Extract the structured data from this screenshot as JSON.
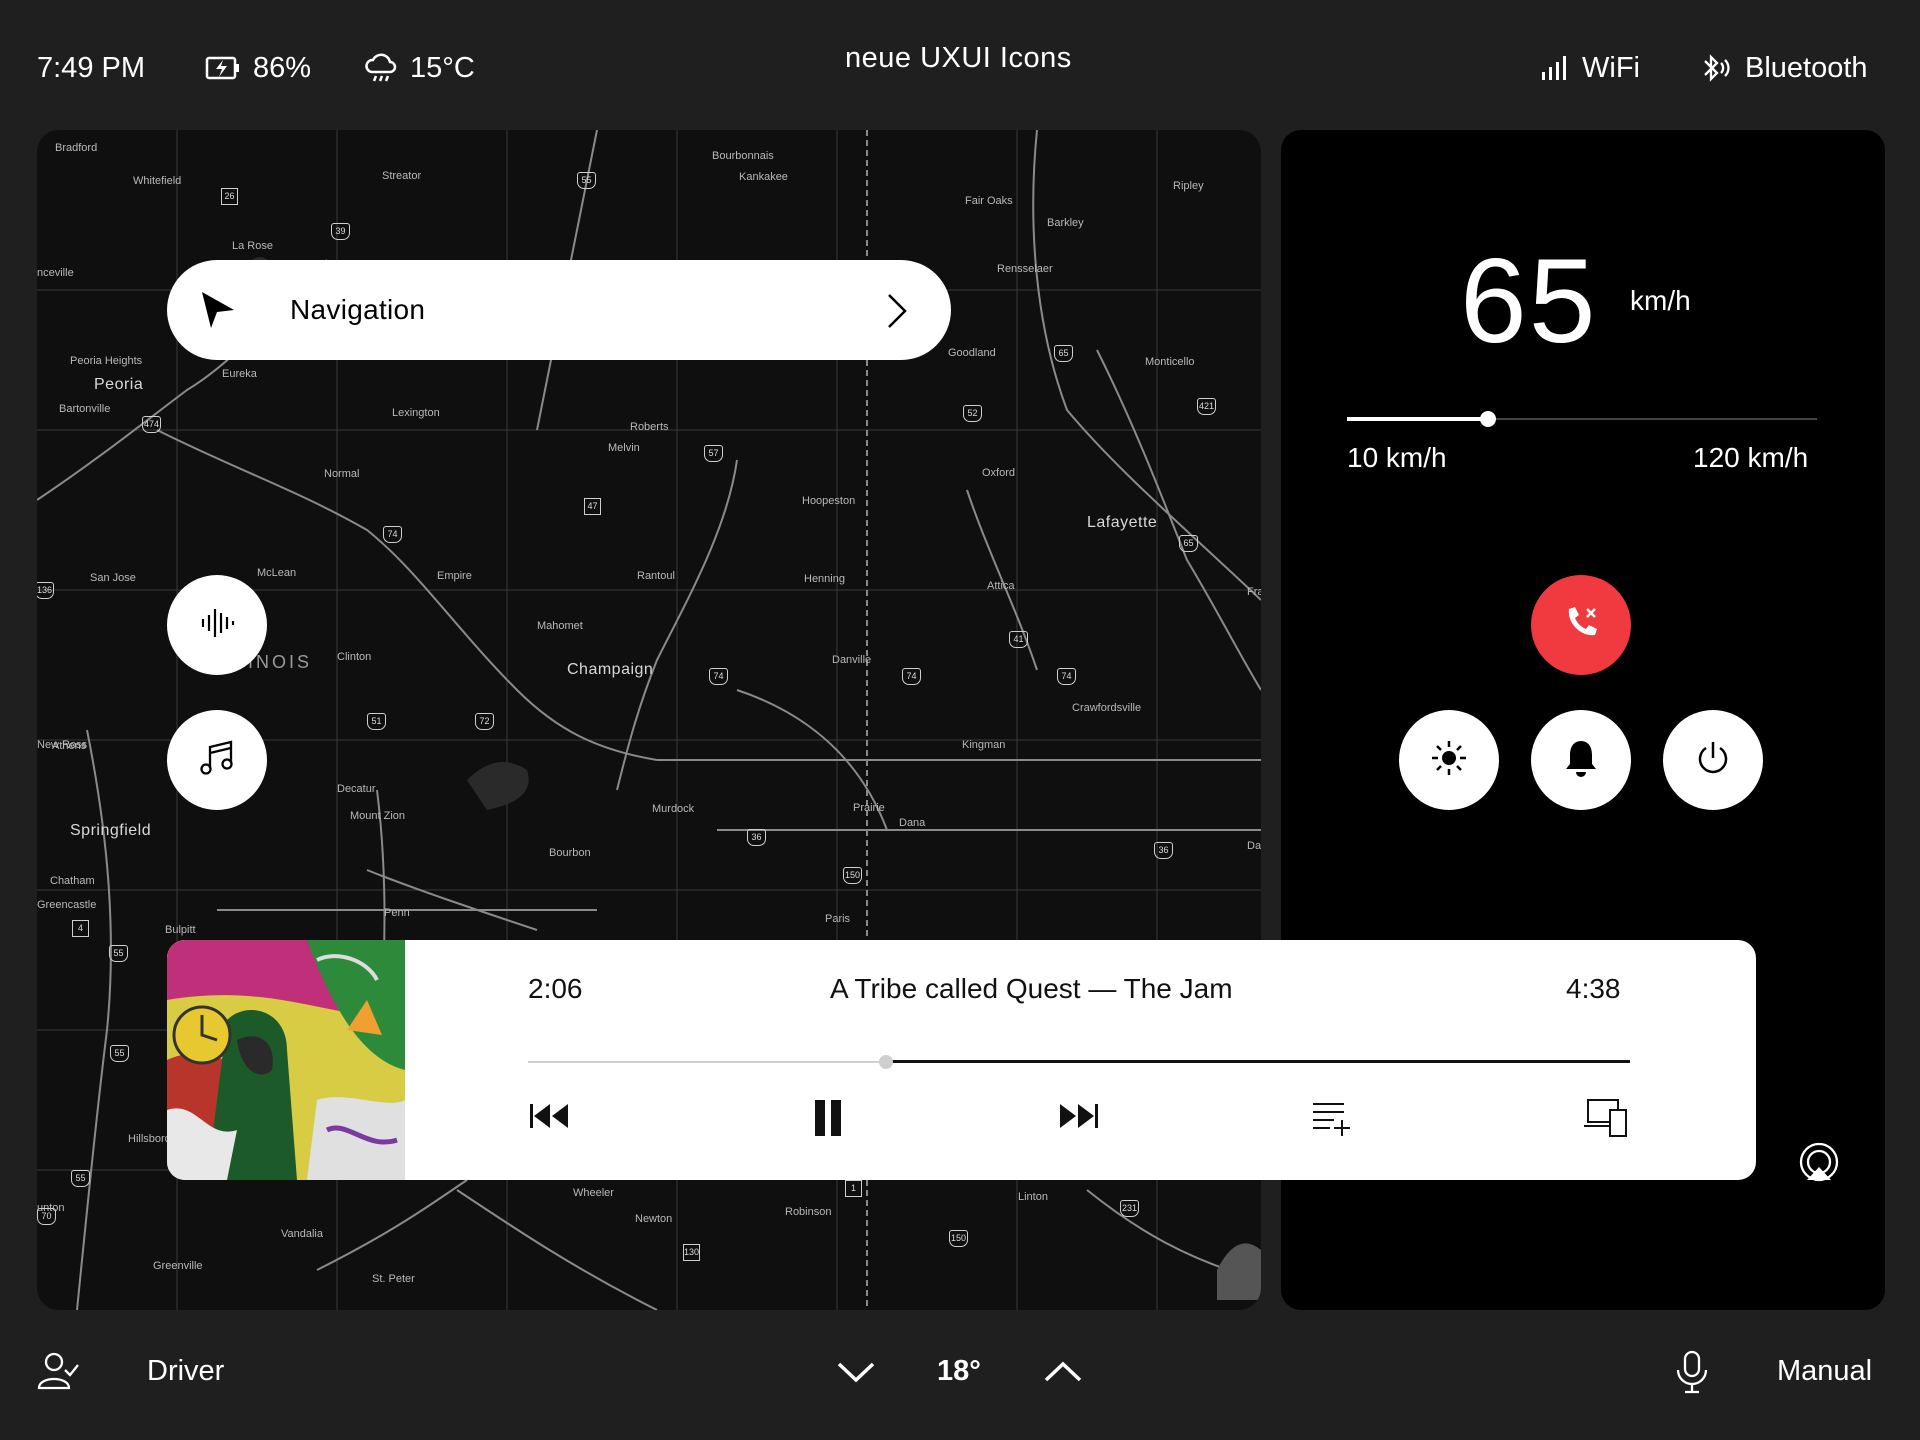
{
  "status_bar": {
    "time": "7:49 PM",
    "battery": "86%",
    "weather": "15°C",
    "title": "neue UXUI Icons",
    "wifi": "WiFi",
    "bluetooth": "Bluetooth"
  },
  "map": {
    "cities": [
      {
        "name": "Bradford"
      },
      {
        "name": "Whitefield"
      },
      {
        "name": "La Rose"
      },
      {
        "name": "Streator"
      },
      {
        "name": "Bourbonnais"
      },
      {
        "name": "Kankakee"
      },
      {
        "name": "Fair Oaks"
      },
      {
        "name": "Ripley"
      },
      {
        "name": "Barkley"
      },
      {
        "name": "Rensselaer"
      },
      {
        "name": "nceville"
      },
      {
        "name": "Peoria Heights"
      },
      {
        "name": "Eureka"
      },
      {
        "name": "Bartonville"
      },
      {
        "name": "Lexington"
      },
      {
        "name": "Roberts"
      },
      {
        "name": "Melvin"
      },
      {
        "name": "Goodland"
      },
      {
        "name": "Monticello"
      },
      {
        "name": "Normal"
      },
      {
        "name": "Oxford"
      },
      {
        "name": "Hoopeston"
      },
      {
        "name": "San Jose"
      },
      {
        "name": "McLean"
      },
      {
        "name": "Empire"
      },
      {
        "name": "Rantoul"
      },
      {
        "name": "Henning"
      },
      {
        "name": "Attica"
      },
      {
        "name": "Mahomet"
      },
      {
        "name": "Clinton"
      },
      {
        "name": "Danville"
      },
      {
        "name": "Crawfordsville"
      },
      {
        "name": "Athens"
      },
      {
        "name": "Kingman"
      },
      {
        "name": "New Ross"
      },
      {
        "name": "Decatur"
      },
      {
        "name": "Mount Zion"
      },
      {
        "name": "Murdock"
      },
      {
        "name": "Prairie"
      },
      {
        "name": "Dana"
      },
      {
        "name": "Chatham"
      },
      {
        "name": "Bourbon"
      },
      {
        "name": "Penn"
      },
      {
        "name": "Paris"
      },
      {
        "name": "Greencastle"
      },
      {
        "name": "Bulpitt"
      },
      {
        "name": "Hillsboro"
      },
      {
        "name": "Wheeler"
      },
      {
        "name": "Newton"
      },
      {
        "name": "Robinson"
      },
      {
        "name": "Linton"
      },
      {
        "name": "unton"
      },
      {
        "name": "Vandalia"
      },
      {
        "name": "Greenville"
      },
      {
        "name": "St. Peter"
      },
      {
        "name": "Dai"
      },
      {
        "name": "Fra"
      }
    ],
    "big_cities": [
      {
        "name": "Peoria"
      },
      {
        "name": "Champaign"
      },
      {
        "name": "Lafayette"
      },
      {
        "name": "Springfield"
      }
    ],
    "state_label": "INOIS",
    "shields": [
      {
        "num": "55"
      },
      {
        "num": "39"
      },
      {
        "num": "474"
      },
      {
        "num": "57"
      },
      {
        "num": "74"
      },
      {
        "num": "52"
      },
      {
        "num": "65"
      },
      {
        "num": "421"
      },
      {
        "num": "65"
      },
      {
        "num": "41"
      },
      {
        "num": "74"
      },
      {
        "num": "74"
      },
      {
        "num": "74"
      },
      {
        "num": "51"
      },
      {
        "num": "72"
      },
      {
        "num": "136"
      },
      {
        "num": "36"
      },
      {
        "num": "150"
      },
      {
        "num": "36"
      },
      {
        "num": "55"
      },
      {
        "num": "55"
      },
      {
        "num": "55"
      },
      {
        "num": "70"
      },
      {
        "num": "150"
      },
      {
        "num": "231"
      }
    ],
    "box_shields": [
      {
        "num": "26"
      },
      {
        "num": "47"
      },
      {
        "num": "4"
      },
      {
        "num": "1"
      },
      {
        "num": "130"
      }
    ]
  },
  "navigation": {
    "label": "Navigation",
    "icons": {
      "arrow": "navigation-arrow-icon",
      "chevron": "chevron-right-icon"
    }
  },
  "side_buttons": {
    "voice_icon": "audio-waveform-icon",
    "music_icon": "music-note-icon"
  },
  "speed": {
    "value": "65",
    "unit": "km/h",
    "slider_min": "10 km/h",
    "slider_max": "120 km/h",
    "slider_fraction": 0.3
  },
  "controls": {
    "end_call_color": "#f03a3f",
    "icons": [
      "end-call-icon",
      "brightness-icon",
      "bell-icon",
      "power-icon"
    ]
  },
  "player": {
    "elapsed": "2:06",
    "track": "A Tribe called Quest — The Jam",
    "duration": "4:38",
    "progress_fraction": 0.325,
    "icons": [
      "previous-icon",
      "pause-icon",
      "next-icon",
      "add-to-queue-icon",
      "devices-icon"
    ]
  },
  "airplay_icon": "airplay-icon",
  "bottom_bar": {
    "profile_label": "Driver",
    "temperature": "18°",
    "mode": "Manual",
    "icons": [
      "user-check-icon",
      "chevron-down-icon",
      "chevron-up-icon",
      "microphone-icon"
    ]
  },
  "colors": {
    "background": "#1f1f1f",
    "panel": "#000000",
    "map": "#0f0f0f",
    "accent_red": "#f03a3f",
    "white": "#ffffff"
  }
}
